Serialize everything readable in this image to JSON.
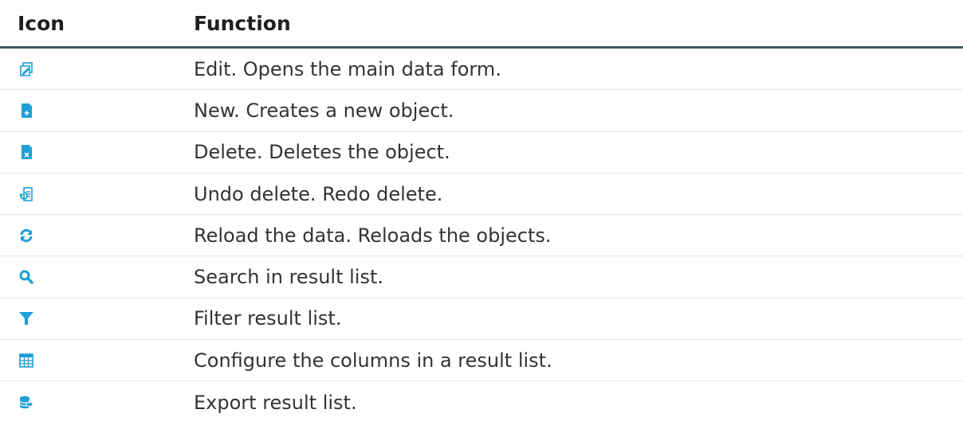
{
  "table": {
    "headers": {
      "icon": "Icon",
      "function": "Function"
    },
    "accent_color": "#1e9fd6",
    "rows": [
      {
        "icon": "edit-icon",
        "function": "Edit. Opens the main data form."
      },
      {
        "icon": "new-object-icon",
        "function": "New. Creates a new object."
      },
      {
        "icon": "delete-object-icon",
        "function": "Delete. Deletes the object."
      },
      {
        "icon": "undo-delete-icon",
        "function": "Undo delete. Redo delete."
      },
      {
        "icon": "reload-icon",
        "function": "Reload the data. Reloads the objects."
      },
      {
        "icon": "search-icon",
        "function": "Search in result list."
      },
      {
        "icon": "filter-icon",
        "function": "Filter result list."
      },
      {
        "icon": "columns-icon",
        "function": "Configure the columns in a result list."
      },
      {
        "icon": "export-icon",
        "function": "Export result list."
      }
    ]
  }
}
